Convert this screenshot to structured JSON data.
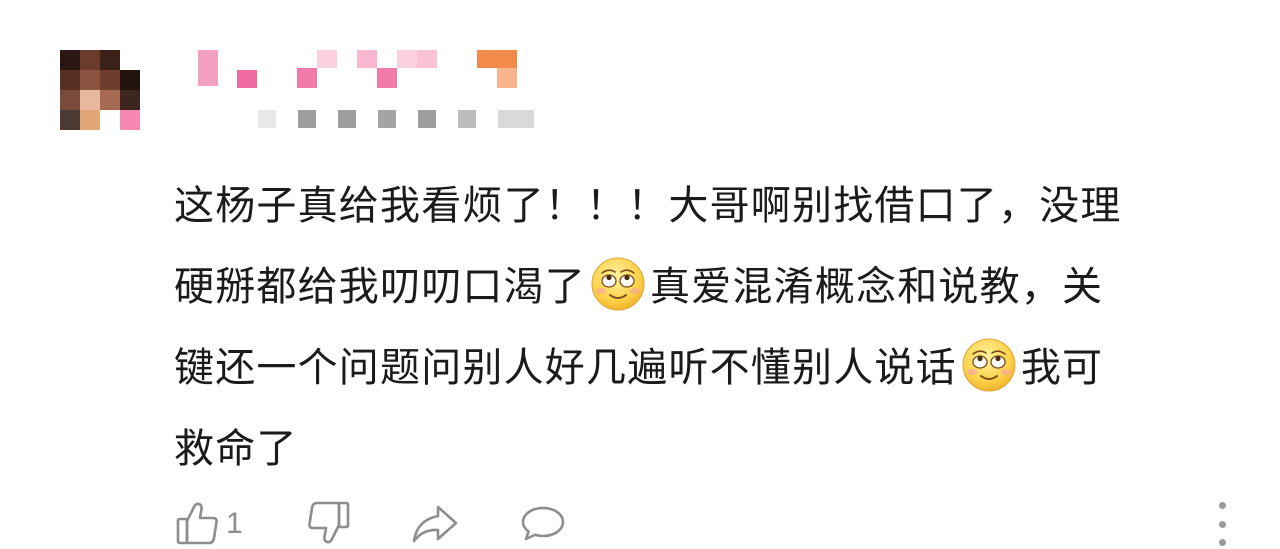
{
  "comment": {
    "text_1": "这杨子真给我看烦了！！！大哥啊别找借口了，没理",
    "text_2": "硬掰都给我叨叨口渴了",
    "text_3": "真爱混淆概念和说教，关",
    "text_4": "键还一个问题问别人好几遍听不懂别人说话",
    "text_5": "我可",
    "text_6": "救命了",
    "emoji_name": "relieved-rolling-eyes-emoji"
  },
  "actions": {
    "like_count": "1",
    "icons": [
      "thumbs-up-icon",
      "thumbs-down-icon",
      "share-icon",
      "comment-icon",
      "more-icon"
    ]
  },
  "colors": {
    "text": "#1b1b1b",
    "icon": "#8e8e8e",
    "mosaic_pink": "#f589b3",
    "mosaic_orange": "#f28b4a"
  }
}
